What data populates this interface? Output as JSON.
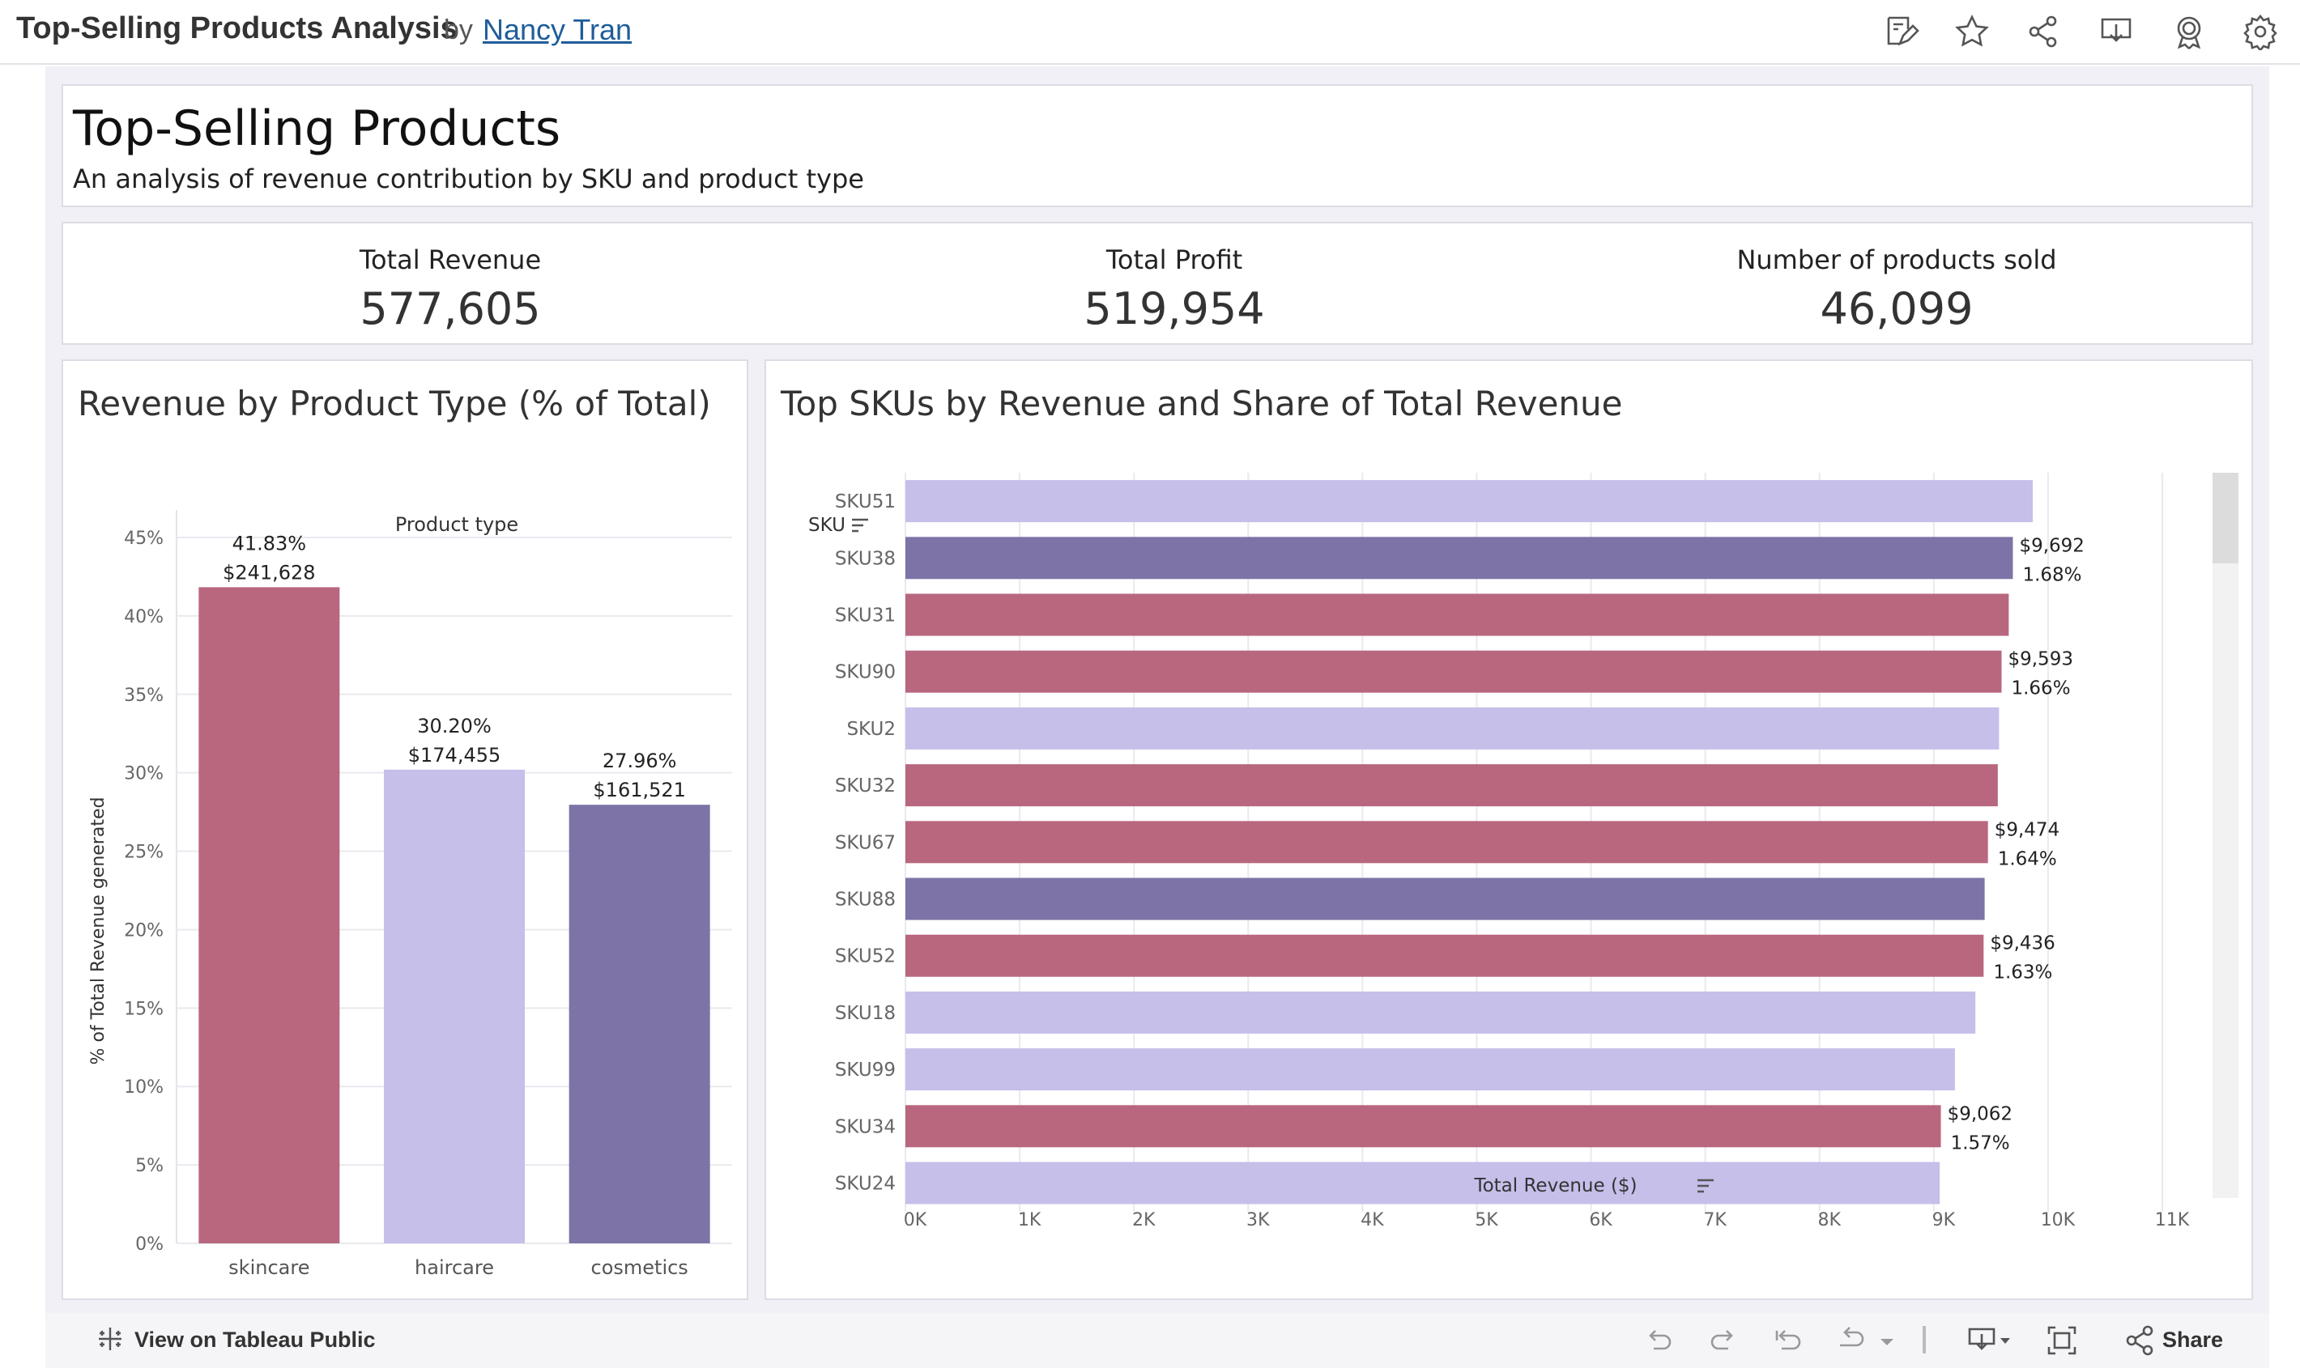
{
  "header": {
    "title": "Top-Selling Products Analysis",
    "by": "by",
    "author": "Nancy Tran",
    "icons": [
      "edit-icon",
      "star-icon",
      "share-icon",
      "download-icon",
      "badge-icon",
      "settings-icon"
    ]
  },
  "dashboard": {
    "title": "Top-Selling Products",
    "subtitle": "An analysis of revenue contribution by SKU and product type"
  },
  "kpis": [
    {
      "label": "Total Revenue",
      "value": "577,605"
    },
    {
      "label": "Total Profit",
      "value": "519,954"
    },
    {
      "label": "Number of products sold",
      "value": "46,099"
    }
  ],
  "colors": {
    "skincare": "#b8677f",
    "haircare": "#c5bfea",
    "cosmetics": "#7d73a6",
    "grid": "#e9e9ef"
  },
  "chart_data": [
    {
      "type": "bar",
      "title": "Revenue by Product Type (% of Total)",
      "header": "Product type",
      "ylabel": "% of Total Revenue generated",
      "ylim": [
        0,
        45
      ],
      "yticks": [
        "0%",
        "5%",
        "10%",
        "15%",
        "20%",
        "25%",
        "30%",
        "35%",
        "40%",
        "45%"
      ],
      "categories": [
        "skincare",
        "haircare",
        "cosmetics"
      ],
      "values": [
        41.83,
        30.2,
        27.96
      ],
      "labels_pct": [
        "41.83%",
        "30.20%",
        "27.96%"
      ],
      "labels_rev": [
        "$241,628",
        "$174,455",
        "$161,521"
      ],
      "colors": [
        "#b8677f",
        "#c5bfea",
        "#7d73a6"
      ],
      "grid": true
    },
    {
      "type": "bar",
      "orientation": "horizontal",
      "title": "Top SKUs by Revenue and Share of Total Revenue",
      "ylabel": "SKU",
      "xlabel": "Total Revenue ($)",
      "xlim": [
        0,
        11000
      ],
      "xticks": [
        "0K",
        "1K",
        "2K",
        "3K",
        "4K",
        "5K",
        "6K",
        "7K",
        "8K",
        "9K",
        "10K",
        "11K"
      ],
      "categories": [
        "SKU51",
        "SKU38",
        "SKU31",
        "SKU90",
        "SKU2",
        "SKU32",
        "SKU67",
        "SKU88",
        "SKU52",
        "SKU18",
        "SKU99",
        "SKU34",
        "SKU24"
      ],
      "values": [
        9866,
        9692,
        9656,
        9593,
        9571,
        9560,
        9474,
        9445,
        9436,
        9364,
        9185,
        9062,
        9052
      ],
      "product_types": [
        "haircare",
        "cosmetics",
        "skincare",
        "skincare",
        "haircare",
        "skincare",
        "skincare",
        "cosmetics",
        "skincare",
        "haircare",
        "haircare",
        "skincare",
        "haircare"
      ],
      "label_rev": [
        "",
        "$9,692",
        "",
        "$9,593",
        "",
        "",
        "$9,474",
        "",
        "$9,436",
        "",
        "",
        "$9,062",
        ""
      ],
      "label_pct": [
        "",
        "1.68%",
        "",
        "1.66%",
        "",
        "",
        "1.64%",
        "",
        "1.63%",
        "",
        "",
        "1.57%",
        ""
      ],
      "grid": true
    }
  ],
  "toolbar": {
    "view_on_public": "View on Tableau Public",
    "share": "Share"
  }
}
